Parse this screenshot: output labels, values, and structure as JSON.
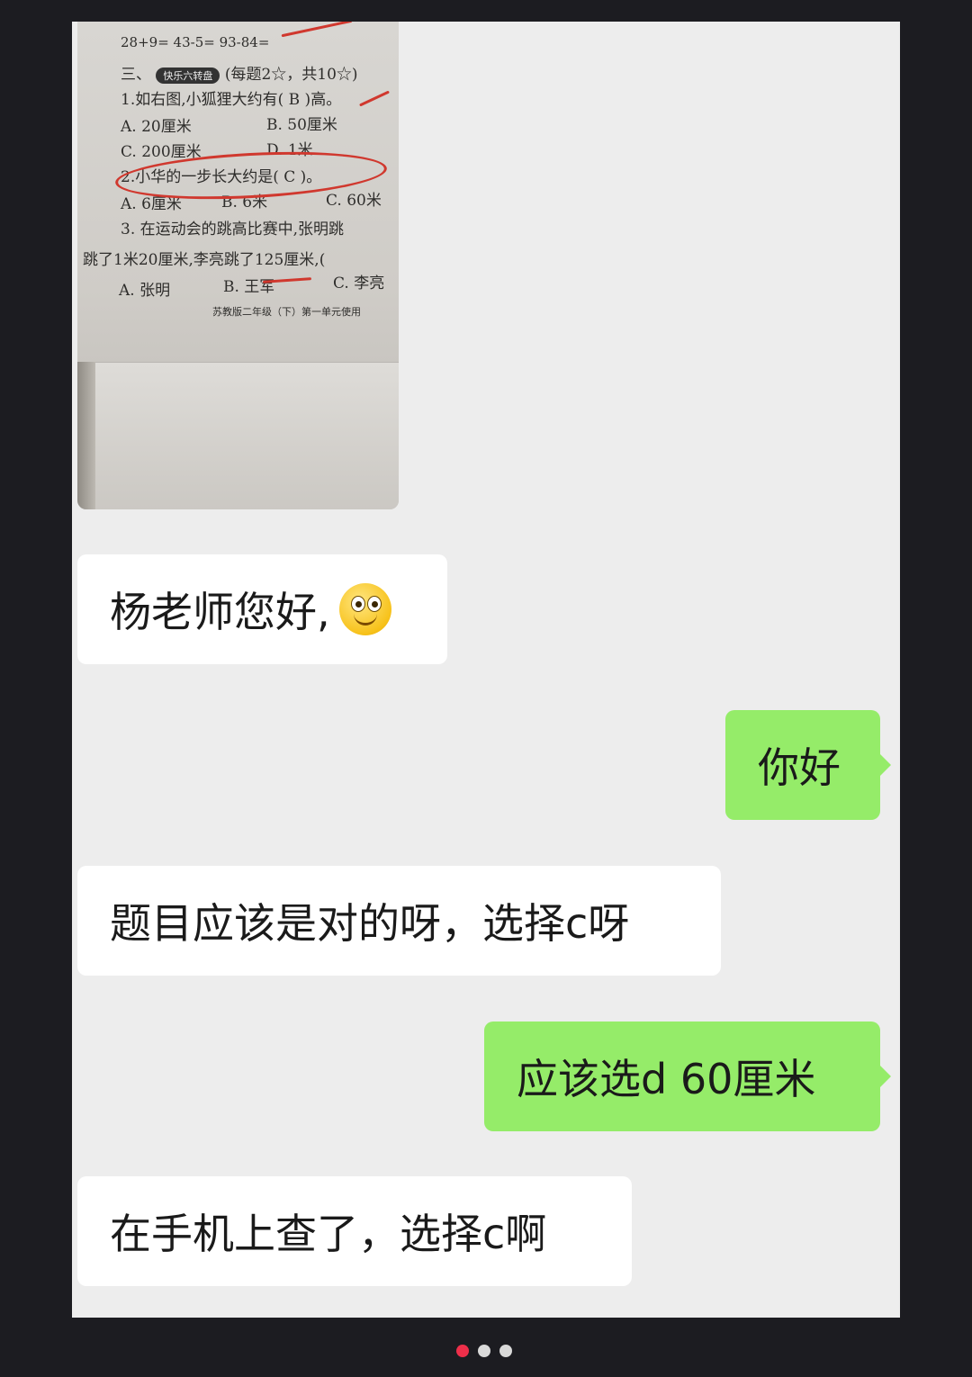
{
  "photo": {
    "worksheet_lines": [
      "28+9=          43-5=            93-84=",
      "三、",
      "快乐六转盘",
      "(每题2☆，共10☆)",
      "1.如右图,小狐狸大约有(  B  )高。",
      "A. 20厘米",
      "B. 50厘米",
      "C. 200厘米",
      "D. 1米",
      "2.小华的一步长大约是(  C  )。",
      "A. 6厘米",
      "B. 6米",
      "C. 60米",
      "3. 在运动会的跳高比赛中,张明跳",
      "跳了1米20厘米,李亮跳了125厘米,(",
      "A. 张明",
      "B. 王军",
      "C. 李亮",
      "苏教版二年级（下）第一单元使用"
    ]
  },
  "messages": [
    {
      "side": "left",
      "text": "杨老师您好,",
      "emoji": "smile-emoji"
    },
    {
      "side": "right",
      "text": "你好"
    },
    {
      "side": "left",
      "text": "题目应该是对的呀，选择c呀"
    },
    {
      "side": "right",
      "text": "应该选d 60厘米"
    },
    {
      "side": "left",
      "text": "在手机上查了，选择c啊"
    }
  ],
  "colors": {
    "outgoing_bubble": "#95ec69",
    "incoming_bubble": "#ffffff",
    "chat_background": "#ededed",
    "active_dot": "#ee2f4a"
  }
}
